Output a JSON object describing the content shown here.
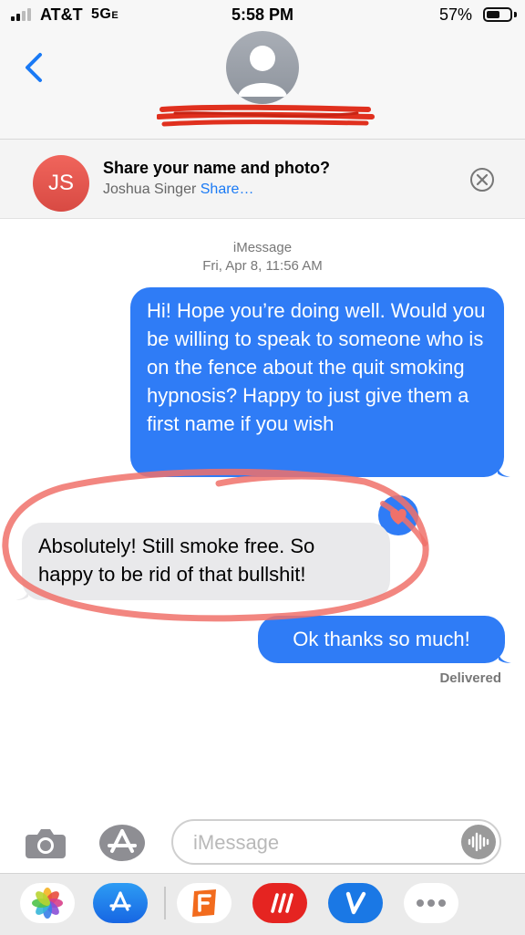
{
  "status_bar": {
    "carrier": "AT&T",
    "network": "5G",
    "network_suffix": "E",
    "time": "5:58 PM",
    "battery": "57%",
    "battery_level": 0.57
  },
  "banner": {
    "initials": "JS",
    "title": "Share your name and photo?",
    "name": "Joshua Singer",
    "share_link": "Share…"
  },
  "thread": {
    "service": "iMessage",
    "timestamp": "Fri, Apr 8, 11:56 AM",
    "messages": [
      {
        "from": "me",
        "text": "Hi! Hope you’re doing well. Would you be willing to speak to someone who is on the fence about the quit smoking hypnosis? Happy to just give them a first name if you wish"
      },
      {
        "from": "them",
        "text": "Absolutely! Still smoke free. So happy to be rid of that bullshit!"
      },
      {
        "from": "me",
        "text": "Ok thanks so much!"
      }
    ],
    "receipt": "Delivered"
  },
  "input": {
    "placeholder": "iMessage"
  },
  "app_drawer": {
    "apps": [
      "photos-icon",
      "app-store-icon",
      "fandango-icon",
      "digital-touch-icon",
      "venmo-icon",
      "more-icon"
    ]
  },
  "colors": {
    "sent_bubble": "#2f7cf6",
    "received_bubble": "#e9e9eb",
    "annotation": "#f0716a",
    "redaction": "#e0301e",
    "link": "#1a7af5"
  }
}
